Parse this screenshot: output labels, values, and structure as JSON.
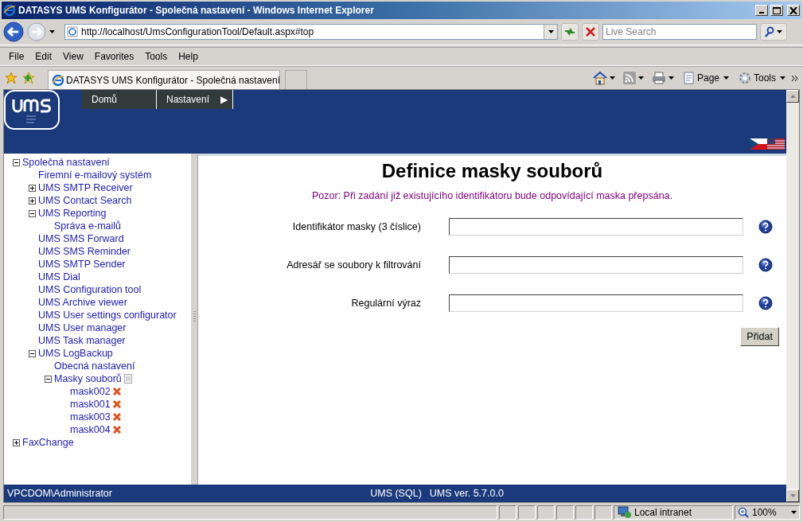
{
  "window": {
    "title": "DATASYS UMS Konfigurátor - Společná nastavení - Windows Internet Explorer"
  },
  "address_bar": {
    "url": "http://localhost/UmsConfigurationTool/Default.aspx#top"
  },
  "search": {
    "placeholder": "Live Search"
  },
  "menu_bar": [
    "File",
    "Edit",
    "View",
    "Favorites",
    "Tools",
    "Help"
  ],
  "tab": {
    "title": "DATASYS UMS Konfigurátor - Společná nastavení"
  },
  "command_bar": [
    "Page",
    "Tools"
  ],
  "header": {
    "nav": [
      {
        "label": "Domů"
      },
      {
        "label": "Nastavení",
        "submenu_mark": "▶"
      }
    ]
  },
  "tree": [
    {
      "label": "Společná nastavení",
      "expanded": true,
      "children": [
        {
          "label": "Firemní e-mailový systém"
        },
        {
          "label": "UMS SMTP Receiver",
          "expanded": false
        },
        {
          "label": "UMS Contact Search",
          "expanded": false
        },
        {
          "label": "UMS Reporting",
          "expanded": true,
          "children": [
            {
              "label": "Správa e-mailů"
            }
          ]
        },
        {
          "label": "UMS SMS Forward"
        },
        {
          "label": "UMS SMS Reminder"
        },
        {
          "label": "UMS SMTP Sender"
        },
        {
          "label": "UMS Dial"
        },
        {
          "label": "UMS Configuration tool"
        },
        {
          "label": "UMS Archive viewer"
        },
        {
          "label": "UMS User settings configurator"
        },
        {
          "label": "UMS User manager"
        },
        {
          "label": "UMS Task manager"
        },
        {
          "label": "UMS LogBackup",
          "expanded": true,
          "children": [
            {
              "label": "Obecná nastavení"
            },
            {
              "label": "Masky souborů",
              "kind": "addable",
              "expanded": true,
              "children": [
                {
                  "label": "mask002",
                  "kind": "deletable"
                },
                {
                  "label": "mask001",
                  "kind": "deletable"
                },
                {
                  "label": "mask003",
                  "kind": "deletable"
                },
                {
                  "label": "mask004",
                  "kind": "deletable"
                }
              ]
            }
          ]
        }
      ]
    },
    {
      "label": "FaxChange",
      "expanded": false
    }
  ],
  "form": {
    "title": "Definice masky souborů",
    "warning": "Pozor: Při zadání již existujícího identifikátoru bude odpovídající maska přepsána.",
    "fields": [
      {
        "label": "Identifikátor masky (3 číslice)"
      },
      {
        "label": "Adresář se soubory k filtrování"
      },
      {
        "label": "Regulární výraz"
      }
    ],
    "button": "Přidat"
  },
  "footer": {
    "user": "VPCDOM\\Administrator",
    "database": "UMS (SQL)",
    "version": "UMS ver. 5.7.0.0"
  },
  "status_bar": {
    "zone": "Local intranet",
    "zoom": "100%"
  }
}
